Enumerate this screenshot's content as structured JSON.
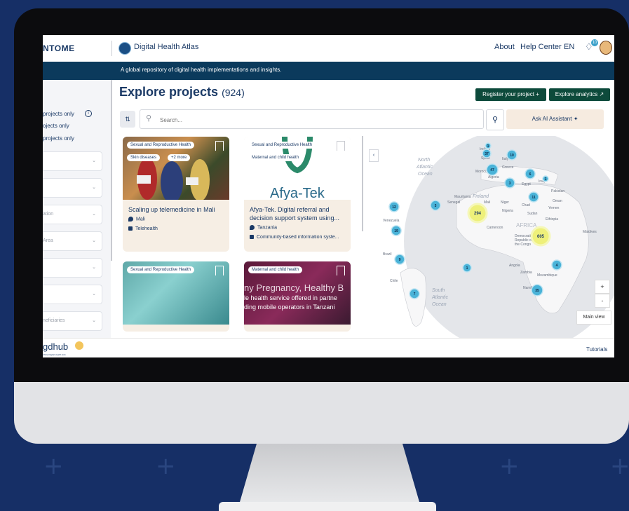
{
  "header": {
    "brand": "NTOME",
    "app_title": "Digital Health Atlas",
    "nav": [
      "About",
      "Help Center",
      "EN"
    ],
    "notifications_count": "10"
  },
  "banner": {
    "tagline": "A global repository of digital health implementations and insights."
  },
  "sidebar": {
    "filter_options": [
      "projects only",
      "ojects only",
      "projects only"
    ],
    "dropdowns": [
      "",
      "",
      "ation",
      "Area",
      "",
      "",
      "neficiaries"
    ]
  },
  "main": {
    "title": "Explore projects",
    "count": "(924)",
    "register_label": "Register your project",
    "analytics_label": "Explore analytics",
    "search_placeholder": "Search...",
    "ai_label": "Ask AI Assistant"
  },
  "cards": [
    {
      "tags": [
        "Sexual and Reproductive Health",
        "Skin diseases",
        "+2 more"
      ],
      "title": "Scaling up telemedicine in Mali",
      "location": "Mali",
      "category": "Telehealth"
    },
    {
      "tags": [
        "Sexual and Reproductive Health",
        "Maternal and child health"
      ],
      "title": "Afya-Tek. Digital referral and decision support system using...",
      "location": "Tanzania",
      "category": "Community-based information syste...",
      "image_text": "Afya-Tek"
    },
    {
      "tags": [
        "Sexual and Reproductive Health"
      ]
    },
    {
      "tags": [
        "Maternal and child health"
      ],
      "image_lines": [
        "ny Pregnancy, Healthy B",
        "le health service offered in partne",
        "ding mobile operators in Tanzani"
      ]
    }
  ],
  "map": {
    "clusters": [
      "1",
      "37",
      "10",
      "47",
      "6",
      "1",
      "3",
      "11",
      "3",
      "12",
      "294",
      "19",
      "605",
      "9",
      "4",
      "1",
      "35",
      "7"
    ],
    "labels": [
      "Finland",
      "Ireland",
      "Spain",
      "Italy",
      "Greece",
      "Morocco",
      "Algeria",
      "Egypt",
      "Iraq",
      "Pakistan",
      "Oman",
      "Yemen",
      "Mauritania",
      "Mali",
      "Niger",
      "Chad",
      "Sudan",
      "Senegal",
      "Nigeria",
      "Ethiopia",
      "Cameroon",
      "AFRICA",
      "Democratic",
      "Republic of",
      "the Congo",
      "Maldives",
      "Venezuela",
      "Brazil",
      "Angola",
      "Zambia",
      "Mozambique",
      "Namibia",
      "Chile",
      "North",
      "Atlantic",
      "Ocean",
      "South",
      "Atlantic",
      "Ocean"
    ],
    "zoom_in": "+",
    "zoom_out": "-",
    "main_view": "Main view"
  },
  "footer": {
    "logo": "gdhub",
    "logo_sub": "Africa Digital Health Hub",
    "tutorials": "Tutorials"
  },
  "colors": {
    "navy": "#1b3a66",
    "banner": "#0b3a5c",
    "button_green": "#0d4a3b",
    "cluster_blue": "#4ab3d8",
    "cluster_yellow": "#eef07a"
  }
}
